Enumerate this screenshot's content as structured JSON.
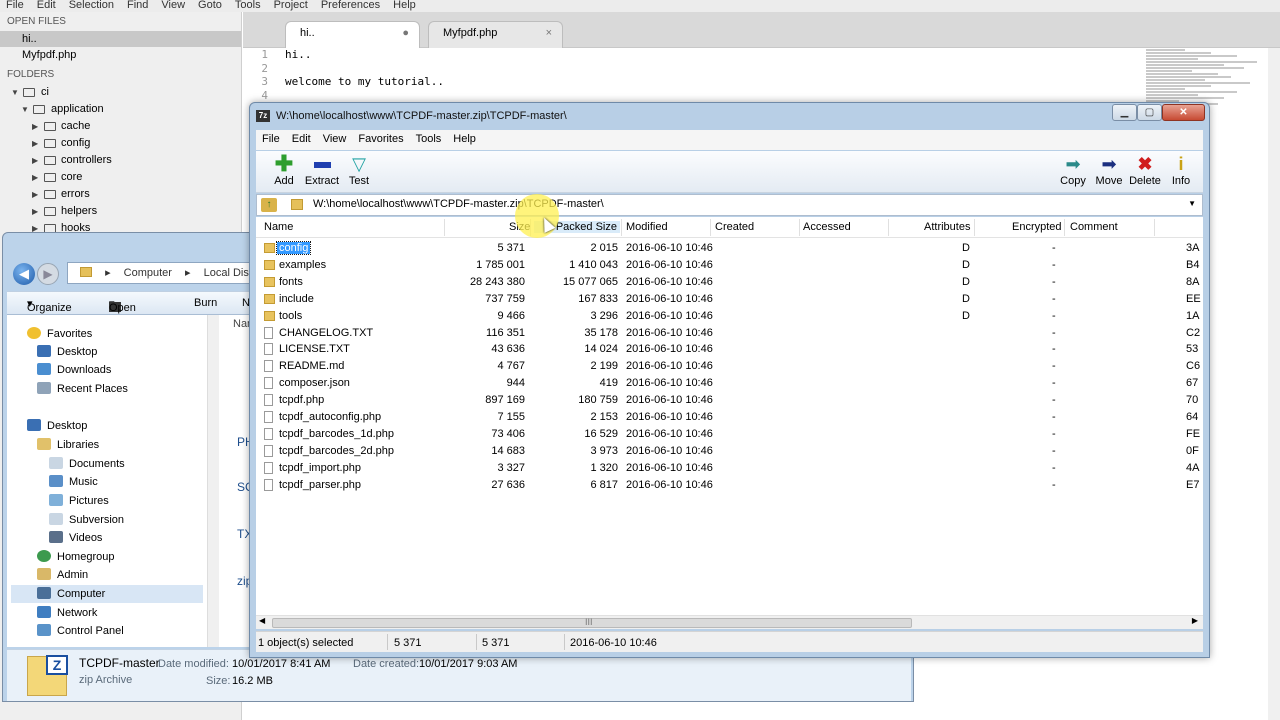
{
  "editor": {
    "menu": [
      "File",
      "Edit",
      "Selection",
      "Find",
      "View",
      "Goto",
      "Tools",
      "Project",
      "Preferences",
      "Help"
    ],
    "sidebar": {
      "open_files_heading": "OPEN FILES",
      "open_files": [
        "hi..",
        "Myfpdf.php"
      ],
      "folders_heading": "FOLDERS",
      "tree": [
        "ci",
        "application",
        "cache",
        "config",
        "controllers",
        "core",
        "errors",
        "helpers",
        "hooks"
      ]
    },
    "tabs": [
      {
        "label": "hi..",
        "close": "●"
      },
      {
        "label": "Myfpdf.php",
        "close": "×"
      }
    ],
    "lines": [
      {
        "n": "1",
        "text": "hi.."
      },
      {
        "n": "2",
        "text": ""
      },
      {
        "n": "3",
        "text": "welcome to my tutorial.."
      },
      {
        "n": "4",
        "text": ""
      }
    ]
  },
  "explorer": {
    "address": [
      "Computer",
      "Local Disk (W:)"
    ],
    "toolbar": {
      "organize": "Organize",
      "open": "Open",
      "burn": "Burn",
      "more": "N"
    },
    "nav": {
      "favorites": "Favorites",
      "desktop": "Desktop",
      "downloads": "Downloads",
      "recent": "Recent Places",
      "desktop2": "Desktop",
      "libraries": "Libraries",
      "documents": "Documents",
      "music": "Music",
      "pictures": "Pictures",
      "subversion": "Subversion",
      "videos": "Videos",
      "homegroup": "Homegroup",
      "admin": "Admin",
      "computer": "Computer",
      "network": "Network",
      "control_panel": "Control Panel"
    },
    "content_fragments": [
      "Nam",
      "PH",
      "SC",
      "TX",
      "zip"
    ],
    "details": {
      "name": "TCPDF-master",
      "type": "zip Archive",
      "modified_label": "Date modified:",
      "modified": "10/01/2017 8:41 AM",
      "created_label": "Date created:",
      "created": "10/01/2017 9:03 AM",
      "size_label": "Size:",
      "size": "16.2 MB"
    }
  },
  "sevenzip": {
    "app_icon": "7z",
    "title": "W:\\home\\localhost\\www\\TCPDF-master.zip\\TCPDF-master\\",
    "window_buttons": [
      "▁",
      "▢",
      "✕"
    ],
    "menu": [
      "File",
      "Edit",
      "View",
      "Favorites",
      "Tools",
      "Help"
    ],
    "toolbar": [
      {
        "label": "Add",
        "icon": "plus-icon",
        "color": "#2e9e2e"
      },
      {
        "label": "Extract",
        "icon": "minus-icon",
        "color": "#1f3fb0"
      },
      {
        "label": "Test",
        "icon": "check-icon",
        "color": "#22a3a3"
      },
      {
        "label": "Copy",
        "icon": "arrow-right-icon",
        "color": "#2a8a8a"
      },
      {
        "label": "Move",
        "icon": "arrow-right-icon",
        "color": "#1b2f80"
      },
      {
        "label": "Delete",
        "icon": "x-icon",
        "color": "#d01d1d"
      },
      {
        "label": "Info",
        "icon": "info-icon",
        "color": "#c9a215"
      }
    ],
    "path": "W:\\home\\localhost\\www\\TCPDF-master.zip\\TCPDF-master\\",
    "columns": [
      "Name",
      "Size",
      "Packed Size",
      "Modified",
      "Created",
      "Accessed",
      "Attributes",
      "Encrypted",
      "Comment"
    ],
    "files": [
      {
        "name": "config",
        "folder": true,
        "size": "5 371",
        "packed": "2 015",
        "modified": "2016-06-10 10:46",
        "attr": "D",
        "enc": "-",
        "comment": "3A"
      },
      {
        "name": "examples",
        "folder": true,
        "size": "1 785 001",
        "packed": "1 410 043",
        "modified": "2016-06-10 10:46",
        "attr": "D",
        "enc": "-",
        "comment": "B4"
      },
      {
        "name": "fonts",
        "folder": true,
        "size": "28 243 380",
        "packed": "15 077 065",
        "modified": "2016-06-10 10:46",
        "attr": "D",
        "enc": "-",
        "comment": "8A"
      },
      {
        "name": "include",
        "folder": true,
        "size": "737 759",
        "packed": "167 833",
        "modified": "2016-06-10 10:46",
        "attr": "D",
        "enc": "-",
        "comment": "EE"
      },
      {
        "name": "tools",
        "folder": true,
        "size": "9 466",
        "packed": "3 296",
        "modified": "2016-06-10 10:46",
        "attr": "D",
        "enc": "-",
        "comment": "1A"
      },
      {
        "name": "CHANGELOG.TXT",
        "folder": false,
        "size": "116 351",
        "packed": "35 178",
        "modified": "2016-06-10 10:46",
        "attr": "",
        "enc": "-",
        "comment": "C2"
      },
      {
        "name": "LICENSE.TXT",
        "folder": false,
        "size": "43 636",
        "packed": "14 024",
        "modified": "2016-06-10 10:46",
        "attr": "",
        "enc": "-",
        "comment": "53"
      },
      {
        "name": "README.md",
        "folder": false,
        "size": "4 767",
        "packed": "2 199",
        "modified": "2016-06-10 10:46",
        "attr": "",
        "enc": "-",
        "comment": "C6"
      },
      {
        "name": "composer.json",
        "folder": false,
        "size": "944",
        "packed": "419",
        "modified": "2016-06-10 10:46",
        "attr": "",
        "enc": "-",
        "comment": "67"
      },
      {
        "name": "tcpdf.php",
        "folder": false,
        "size": "897 169",
        "packed": "180 759",
        "modified": "2016-06-10 10:46",
        "attr": "",
        "enc": "-",
        "comment": "70"
      },
      {
        "name": "tcpdf_autoconfig.php",
        "folder": false,
        "size": "7 155",
        "packed": "2 153",
        "modified": "2016-06-10 10:46",
        "attr": "",
        "enc": "-",
        "comment": "64"
      },
      {
        "name": "tcpdf_barcodes_1d.php",
        "folder": false,
        "size": "73 406",
        "packed": "16 529",
        "modified": "2016-06-10 10:46",
        "attr": "",
        "enc": "-",
        "comment": "FE"
      },
      {
        "name": "tcpdf_barcodes_2d.php",
        "folder": false,
        "size": "14 683",
        "packed": "3 973",
        "modified": "2016-06-10 10:46",
        "attr": "",
        "enc": "-",
        "comment": "0F"
      },
      {
        "name": "tcpdf_import.php",
        "folder": false,
        "size": "3 327",
        "packed": "1 320",
        "modified": "2016-06-10 10:46",
        "attr": "",
        "enc": "-",
        "comment": "4A"
      },
      {
        "name": "tcpdf_parser.php",
        "folder": false,
        "size": "27 636",
        "packed": "6 817",
        "modified": "2016-06-10 10:46",
        "attr": "",
        "enc": "-",
        "comment": "E7"
      }
    ],
    "status": {
      "selected": "1 object(s) selected",
      "size": "5 371",
      "packed": "5 371",
      "modified": "2016-06-10 10:46"
    },
    "scroll_grip": "III"
  }
}
